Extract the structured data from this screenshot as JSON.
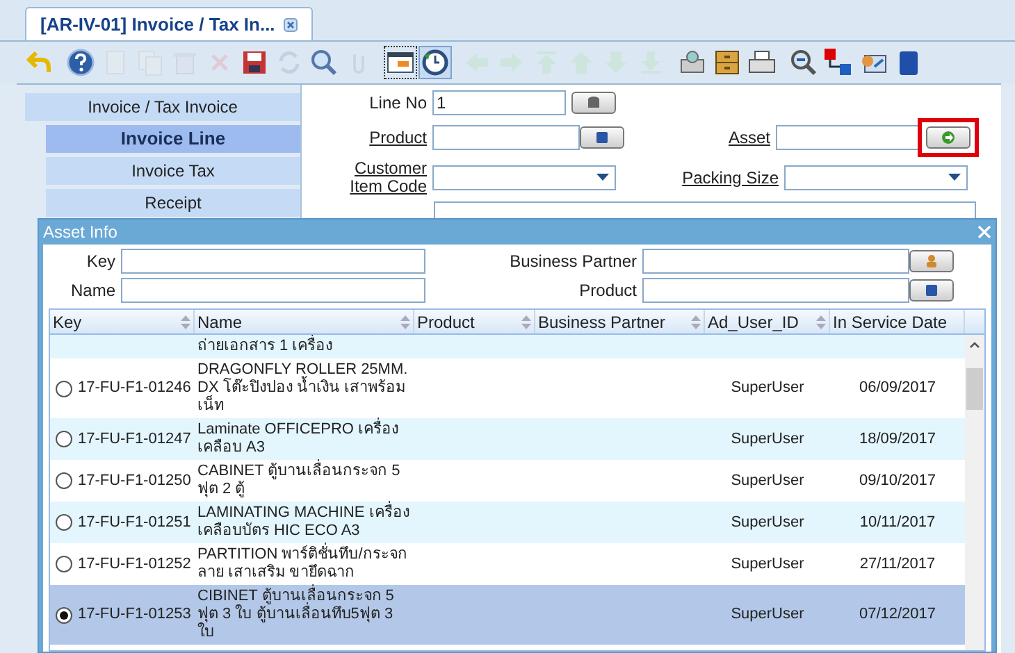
{
  "tab": {
    "title": "[AR-IV-01] Invoice / Tax In...",
    "closable": true
  },
  "toolbar": [
    {
      "kind": "undo",
      "disabled": false,
      "selected": false
    },
    {
      "kind": "help",
      "disabled": false,
      "selected": false
    },
    {
      "kind": "new",
      "disabled": true,
      "selected": false
    },
    {
      "kind": "copy",
      "disabled": true,
      "selected": false
    },
    {
      "kind": "delete",
      "disabled": true,
      "selected": false
    },
    {
      "kind": "cancel",
      "disabled": true,
      "selected": false
    },
    {
      "kind": "save",
      "disabled": false,
      "selected": false
    },
    {
      "kind": "refresh",
      "disabled": true,
      "selected": false
    },
    {
      "kind": "find",
      "disabled": false,
      "selected": false
    },
    {
      "kind": "attach",
      "disabled": true,
      "selected": false
    },
    {
      "kind": "grid",
      "disabled": false,
      "selected": true
    },
    {
      "kind": "history",
      "disabled": false,
      "selected": true
    },
    {
      "kind": "left",
      "disabled": true,
      "selected": false
    },
    {
      "kind": "right",
      "disabled": true,
      "selected": false
    },
    {
      "kind": "first",
      "disabled": true,
      "selected": false
    },
    {
      "kind": "up",
      "disabled": true,
      "selected": false
    },
    {
      "kind": "down",
      "disabled": true,
      "selected": false
    },
    {
      "kind": "last",
      "disabled": true,
      "selected": false
    },
    {
      "kind": "archive",
      "disabled": false,
      "selected": false
    },
    {
      "kind": "cabinet",
      "disabled": false,
      "selected": false
    },
    {
      "kind": "print",
      "disabled": false,
      "selected": false
    },
    {
      "kind": "zoom",
      "disabled": false,
      "selected": false
    },
    {
      "kind": "workflow",
      "disabled": false,
      "selected": false
    },
    {
      "kind": "request",
      "disabled": false,
      "selected": false
    },
    {
      "kind": "block",
      "disabled": false,
      "selected": false
    }
  ],
  "sidebar": {
    "items": [
      {
        "label": "Invoice / Tax Invoice",
        "selected": false,
        "children": [
          {
            "label": "Invoice Line",
            "selected": true
          },
          {
            "label": "Invoice Tax",
            "selected": false
          },
          {
            "label": "Receipt",
            "selected": false
          }
        ]
      }
    ]
  },
  "form": {
    "line_no": {
      "label": "Line No",
      "value": "1"
    },
    "product": {
      "label": "Product"
    },
    "asset": {
      "label": "Asset",
      "highlighted": true
    },
    "customer_item_code": {
      "label": "Customer Item Code"
    },
    "packing_size": {
      "label": "Packing Size"
    }
  },
  "dialog": {
    "title": "Asset Info",
    "filters": [
      {
        "label": "Key",
        "kind": "text"
      },
      {
        "label": "Business Partner",
        "kind": "partner"
      },
      {
        "label": "Name",
        "kind": "text"
      },
      {
        "label": "Product",
        "kind": "product"
      }
    ],
    "columns": [
      "Key",
      "Name",
      "Product",
      "Business Partner",
      "Ad_User_ID",
      "In Service Date"
    ],
    "rows": [
      {
        "key": "",
        "name": "ถ่ายเอกสาร 1 เครื่อง",
        "product": "",
        "partner": "",
        "user": "",
        "date": "",
        "selected": false
      },
      {
        "key": "17-FU-F1-01246",
        "name": "DRAGONFLY ROLLER 25MM. DX โต๊ะปิงปอง น้ำเงิน เสาพร้อมเน็ท",
        "product": "",
        "partner": "",
        "user": "SuperUser",
        "date": "06/09/2017",
        "selected": false
      },
      {
        "key": "17-FU-F1-01247",
        "name": "Laminate OFFICEPRO เครื่องเคลือบ A3",
        "product": "",
        "partner": "",
        "user": "SuperUser",
        "date": "18/09/2017",
        "selected": false
      },
      {
        "key": "17-FU-F1-01250",
        "name": "CABINET ตู้บานเลื่อนกระจก 5 ฟุต 2 ตู้",
        "product": "",
        "partner": "",
        "user": "SuperUser",
        "date": "09/10/2017",
        "selected": false
      },
      {
        "key": "17-FU-F1-01251",
        "name": "LAMINATING MACHINE เครื่องเคลือบบัตร HIC ECO A3",
        "product": "",
        "partner": "",
        "user": "SuperUser",
        "date": "10/11/2017",
        "selected": false
      },
      {
        "key": "17-FU-F1-01252",
        "name": "PARTITION พาร์ติชั่นทึบ/กระจก ลาย เสาเสริม ขายึดฉาก",
        "product": "",
        "partner": "",
        "user": "SuperUser",
        "date": "27/11/2017",
        "selected": false
      },
      {
        "key": "17-FU-F1-01253",
        "name": "CIBINET ตู้บานเลื่อนกระจก 5 ฟุต 3 ใบ ตู้บานเลื่อนทึบ5ฟุต 3 ใบ",
        "product": "",
        "partner": "",
        "user": "SuperUser",
        "date": "07/12/2017",
        "selected": true
      }
    ]
  }
}
